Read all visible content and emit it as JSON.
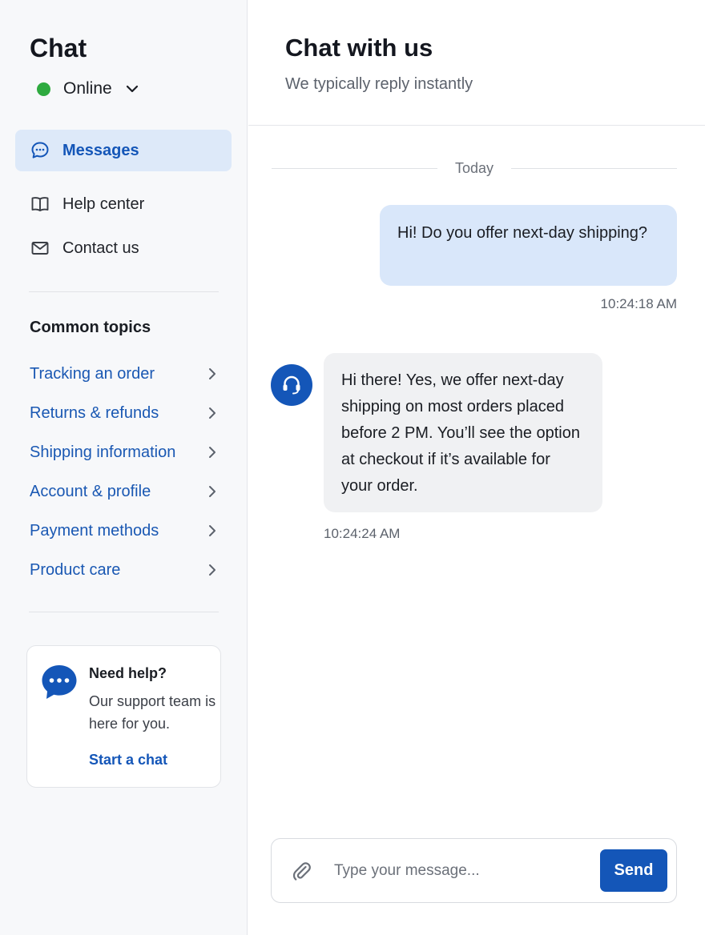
{
  "sidebar": {
    "title": "Chat",
    "status": {
      "label": "Online",
      "color": "#2eaa3f",
      "icon": "chevron-down-icon"
    },
    "nav": [
      {
        "label": "Messages",
        "icon": "chat-bubble-icon",
        "active": true
      },
      {
        "label": "Help center",
        "icon": "book-icon",
        "active": false
      },
      {
        "label": "Contact us",
        "icon": "mail-icon",
        "active": false
      }
    ],
    "topics_title": "Common topics",
    "topics": [
      {
        "label": "Tracking an order"
      },
      {
        "label": "Returns & refunds"
      },
      {
        "label": "Shipping information"
      },
      {
        "label": "Account & profile"
      },
      {
        "label": "Payment methods"
      },
      {
        "label": "Product care"
      }
    ],
    "help_card": {
      "icon": "chat-dots-icon",
      "title": "Need help?",
      "text": "Our support team is here for you.",
      "link": "Start a chat"
    }
  },
  "main": {
    "title": "Chat with us",
    "subtitle": "We typically reply instantly",
    "day_label": "Today",
    "messages": [
      {
        "from": "user",
        "text": "Hi! Do you offer next-day shipping?",
        "time": "10:24:18 AM"
      },
      {
        "from": "agent",
        "avatar_icon": "headset-icon",
        "text": "Hi there! Yes, we offer next-day shipping on most orders placed before 2 PM. You’ll see the option at checkout if it’s available for your order.",
        "time": "10:24:24 AM"
      }
    ],
    "composer": {
      "attach_icon": "paperclip-icon",
      "placeholder": "Type your message...",
      "value": "",
      "send_label": "Send"
    }
  },
  "colors": {
    "accent": "#1456b8",
    "active_nav_bg": "#dde9f9",
    "user_bubble": "#d9e7fa",
    "agent_bubble": "#f0f1f3",
    "online": "#2eaa3f",
    "link": "#1a58b3"
  }
}
